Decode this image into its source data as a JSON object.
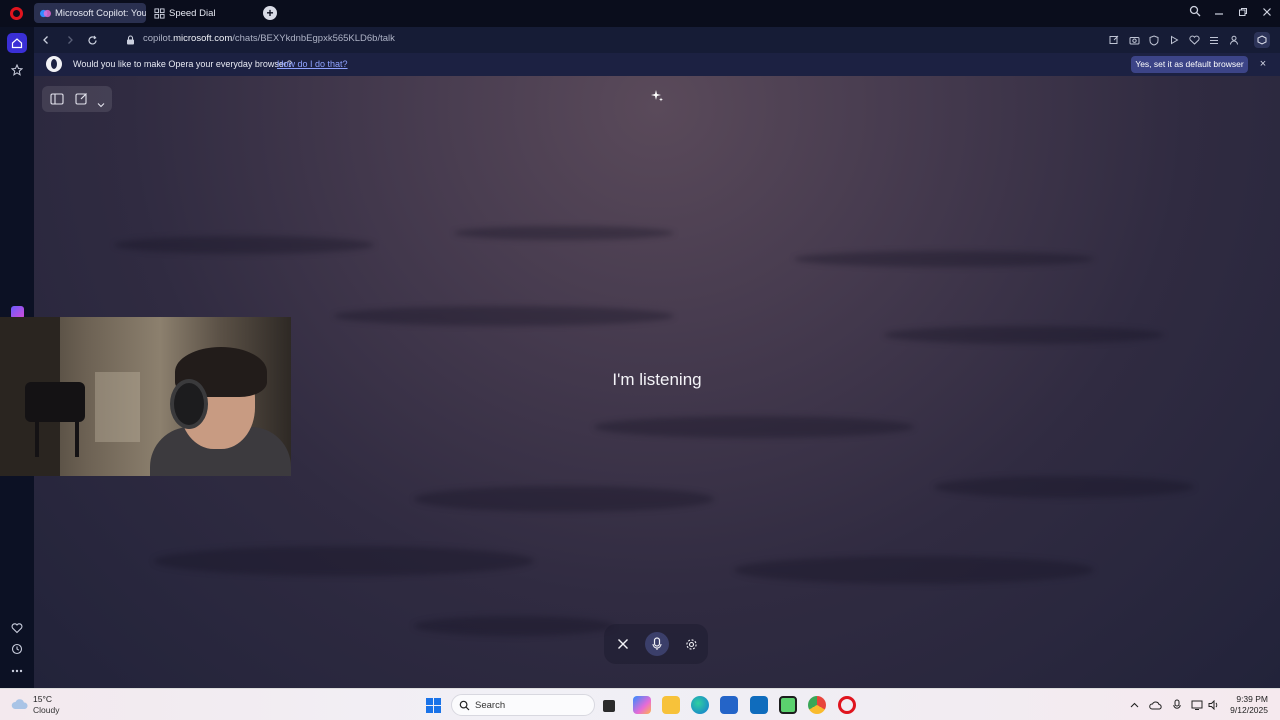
{
  "browser": {
    "tabs": [
      {
        "label": "Microsoft Copilot: Your AI",
        "active": true
      },
      {
        "label": "Speed Dial",
        "active": false
      }
    ],
    "new_tab": "+",
    "url_prefix": "copilot.",
    "url_domain": "microsoft.com",
    "url_path": "/chats/BEXYkdnbEgpxk565KLD6b/talk"
  },
  "infobar": {
    "message": "Would you like to make Opera your everyday browser?",
    "link": "How do I do that?",
    "button": "Yes, set it as default browser",
    "close": "×"
  },
  "content": {
    "status": "I'm listening"
  },
  "taskbar": {
    "weather_temp": "15°C",
    "weather_condition": "Cloudy",
    "search_placeholder": "Search",
    "time": "9:39 PM",
    "date": "9/12/2025"
  },
  "colors": {
    "accent": "#3c4487",
    "opera_red": "#e0141e"
  }
}
